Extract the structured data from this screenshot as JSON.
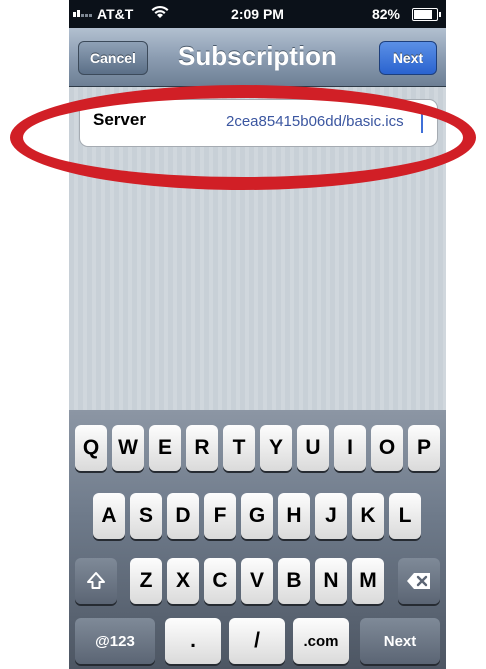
{
  "status_bar": {
    "carrier": "AT&T",
    "time": "2:09 PM",
    "battery": "82%"
  },
  "nav": {
    "title": "Subscription",
    "cancel": "Cancel",
    "next": "Next"
  },
  "form": {
    "server_label": "Server",
    "server_value": "2cea85415b06dd/basic.ics"
  },
  "keyboard": {
    "row1": [
      "Q",
      "W",
      "E",
      "R",
      "T",
      "Y",
      "U",
      "I",
      "O",
      "P"
    ],
    "row2": [
      "A",
      "S",
      "D",
      "F",
      "G",
      "H",
      "J",
      "K",
      "L"
    ],
    "row3": [
      "Z",
      "X",
      "C",
      "V",
      "B",
      "N",
      "M"
    ],
    "numbers_key": "@123",
    "dot_key": ".",
    "slash_key": "/",
    "dotcom_key": ".com",
    "return_key": "Next"
  },
  "colors": {
    "annotation": "#d11f26",
    "nav_next": "#2a63cf"
  }
}
